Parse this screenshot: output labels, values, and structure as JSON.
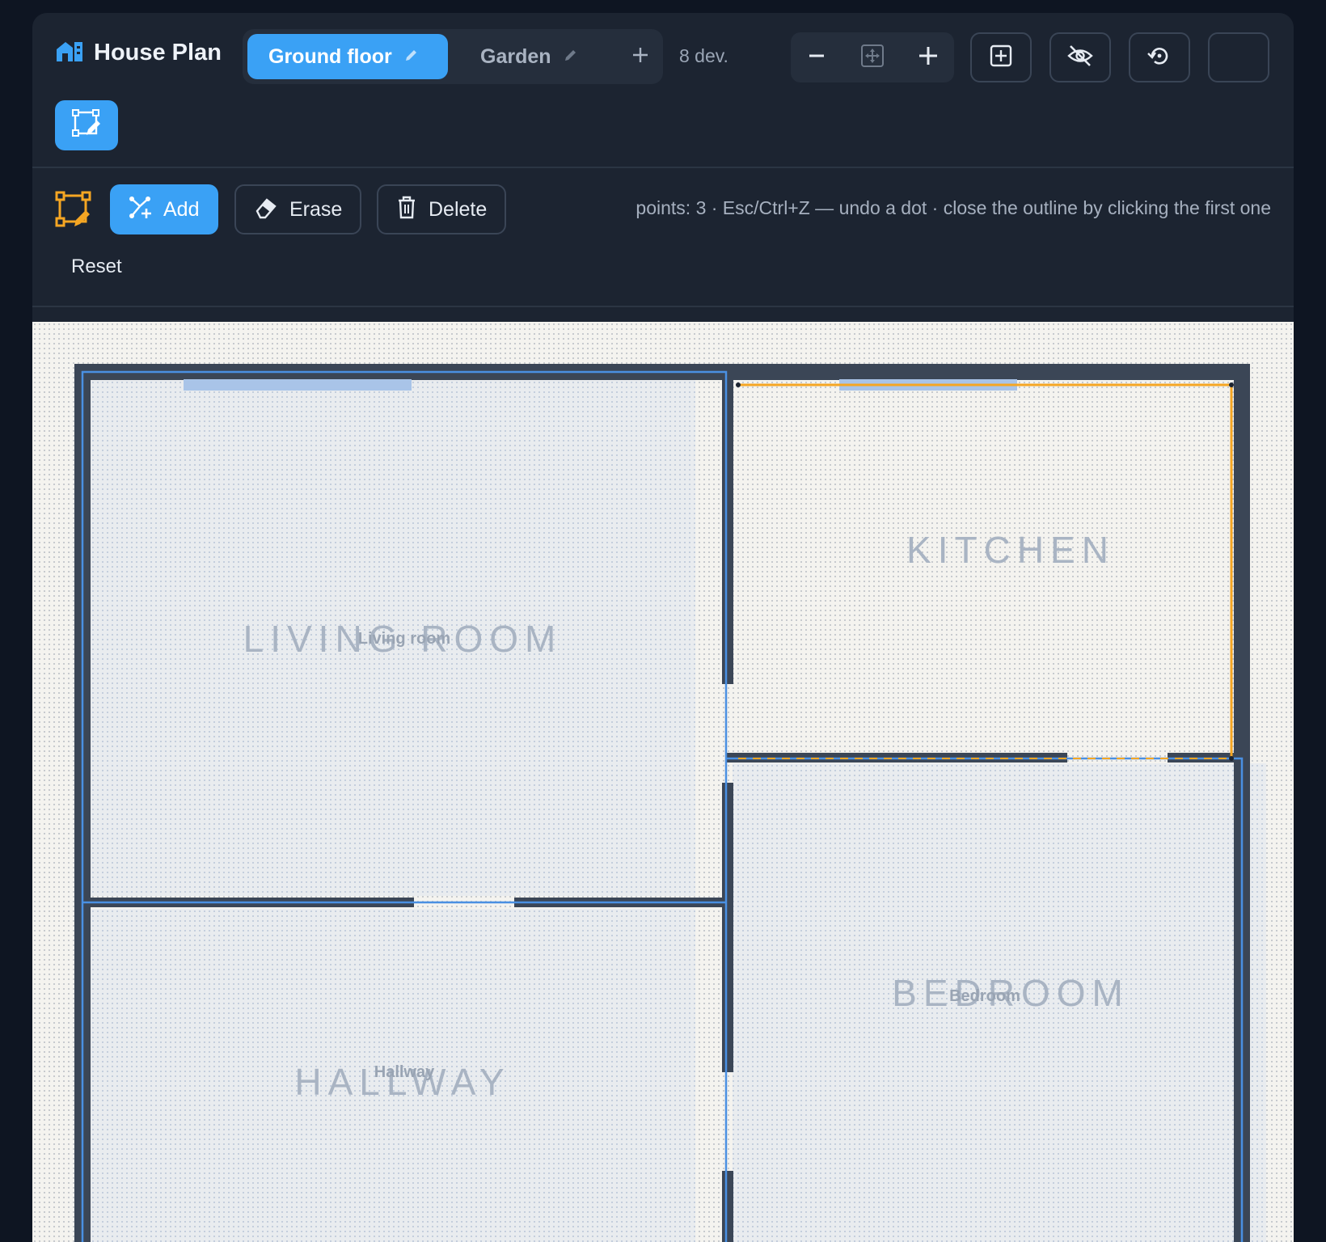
{
  "app": {
    "title": "House Plan"
  },
  "tabs": [
    {
      "label": "Ground floor",
      "active": true
    },
    {
      "label": "Garden",
      "active": false
    }
  ],
  "device_count": "8 dev.",
  "toolbar": {
    "add_label": "Add",
    "erase_label": "Erase",
    "delete_label": "Delete",
    "reset_label": "Reset",
    "hint": "points: 3 · Esc/Ctrl+Z — undo a dot · close the outline by clicking the first one"
  },
  "rooms": {
    "living": {
      "label": "LIVING ROOM",
      "name": "Living room"
    },
    "kitchen": {
      "label": "KITCHEN"
    },
    "bedroom": {
      "label": "BEDROOM",
      "name": "Bedroom"
    },
    "hallway": {
      "label": "HALLWAY",
      "name": "Hallway"
    }
  },
  "colors": {
    "accent": "#3aa1f5",
    "outline_draft": "#f5a623",
    "wall": "#3b4656",
    "room_outline": "#4a90e2"
  },
  "icons": {
    "brand": "house-icon",
    "edit": "pencil-icon",
    "add_tab": "plus-icon",
    "zoom_out": "minus-icon",
    "fit": "fit-screen-icon",
    "zoom_in": "plus-icon",
    "add_device": "add-box-icon",
    "visibility": "eye-off-icon",
    "reset_view": "restore-icon",
    "draw_mode": "polygon-edit-icon"
  }
}
